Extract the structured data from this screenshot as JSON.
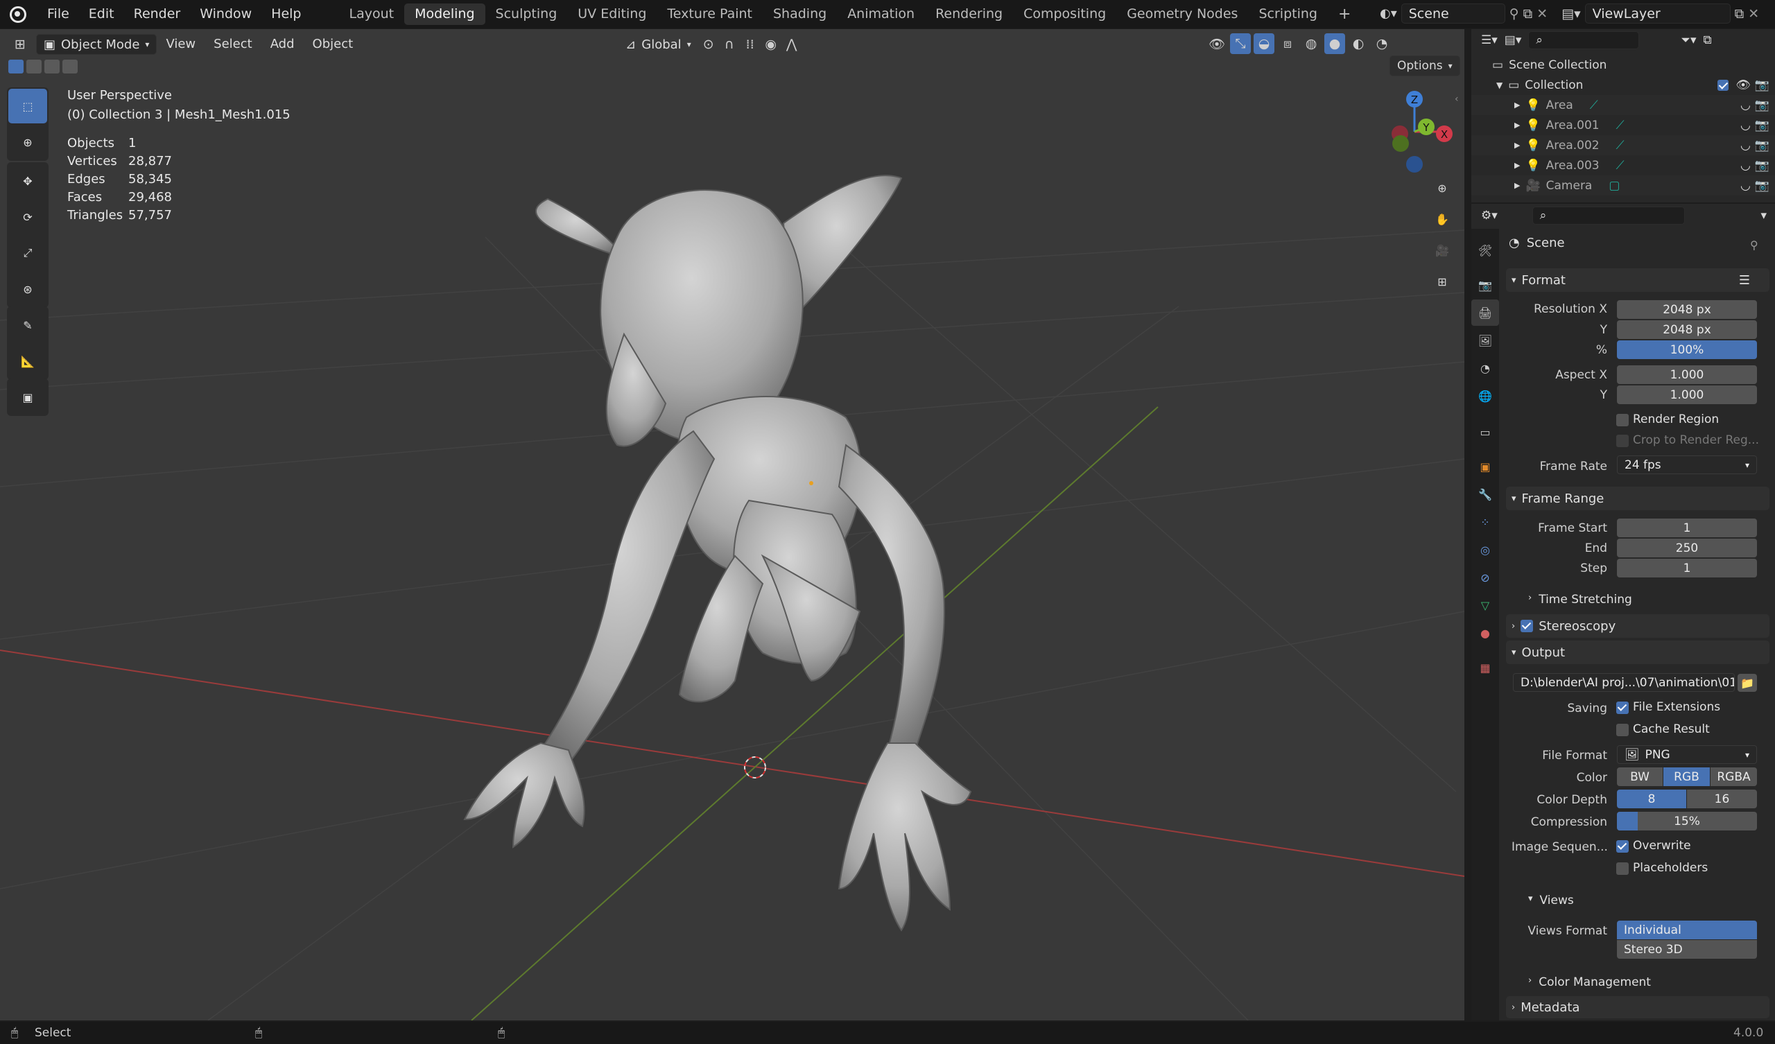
{
  "menus": [
    "File",
    "Edit",
    "Render",
    "Window",
    "Help"
  ],
  "workspaces": [
    "Layout",
    "Modeling",
    "Sculpting",
    "UV Editing",
    "Texture Paint",
    "Shading",
    "Animation",
    "Rendering",
    "Compositing",
    "Geometry Nodes",
    "Scripting"
  ],
  "active_workspace": "Modeling",
  "scene_name": "Scene",
  "view_layer": "ViewLayer",
  "viewport_header": {
    "mode": "Object Mode",
    "menus": [
      "View",
      "Select",
      "Add",
      "Object"
    ],
    "transform_orientation": "Global",
    "options_label": "Options"
  },
  "overlay": {
    "view_name": "User Perspective",
    "collection_info": "(0) Collection 3 | Mesh1_Mesh1.015",
    "stats": [
      {
        "label": "Objects",
        "value": "1"
      },
      {
        "label": "Vertices",
        "value": "28,877"
      },
      {
        "label": "Edges",
        "value": "58,345"
      },
      {
        "label": "Faces",
        "value": "29,468"
      },
      {
        "label": "Triangles",
        "value": "57,757"
      }
    ]
  },
  "gizmo": {
    "x": "X",
    "y": "Y",
    "z": "Z"
  },
  "outliner": {
    "root": "Scene Collection",
    "collection": "Collection",
    "items": [
      "Area",
      "Area.001",
      "Area.002",
      "Area.003",
      "Camera"
    ]
  },
  "properties": {
    "context": "Scene",
    "format": {
      "title": "Format",
      "resolution_x_label": "Resolution X",
      "resolution_x": "2048 px",
      "y_label": "Y",
      "resolution_y": "2048 px",
      "percent_label": "%",
      "percent": "100%",
      "aspect_x_label": "Aspect X",
      "aspect_x": "1.000",
      "aspect_y_label": "Y",
      "aspect_y": "1.000",
      "render_region": "Render Region",
      "crop_region": "Crop to Render Reg...",
      "frame_rate_label": "Frame Rate",
      "frame_rate": "24 fps"
    },
    "frame_range": {
      "title": "Frame Range",
      "start_label": "Frame Start",
      "start": "1",
      "end_label": "End",
      "end": "250",
      "step_label": "Step",
      "step": "1",
      "time_stretching": "Time Stretching"
    },
    "stereoscopy": "Stereoscopy",
    "output": {
      "title": "Output",
      "path": "D:\\blender\\AI proj...\\07\\animation\\01",
      "saving_label": "Saving",
      "file_extensions": "File Extensions",
      "cache_result": "Cache Result",
      "file_format_label": "File Format",
      "file_format": "PNG",
      "color_label": "Color",
      "color_options": [
        "BW",
        "RGB",
        "RGBA"
      ],
      "color_selected": "RGB",
      "color_depth_label": "Color Depth",
      "color_depth_options": [
        "8",
        "16"
      ],
      "color_depth_selected": "8",
      "compression_label": "Compression",
      "compression": "15%",
      "compression_value": 0.15,
      "image_sequence_label": "Image Sequen...",
      "overwrite": "Overwrite",
      "placeholders": "Placeholders",
      "views_title": "Views",
      "views_format_label": "Views Format",
      "views_options": [
        "Individual",
        "Stereo 3D"
      ],
      "views_selected": "Individual",
      "color_management": "Color Management"
    },
    "metadata": "Metadata"
  },
  "statusbar": {
    "left": "Select",
    "version": "4.0.0"
  }
}
